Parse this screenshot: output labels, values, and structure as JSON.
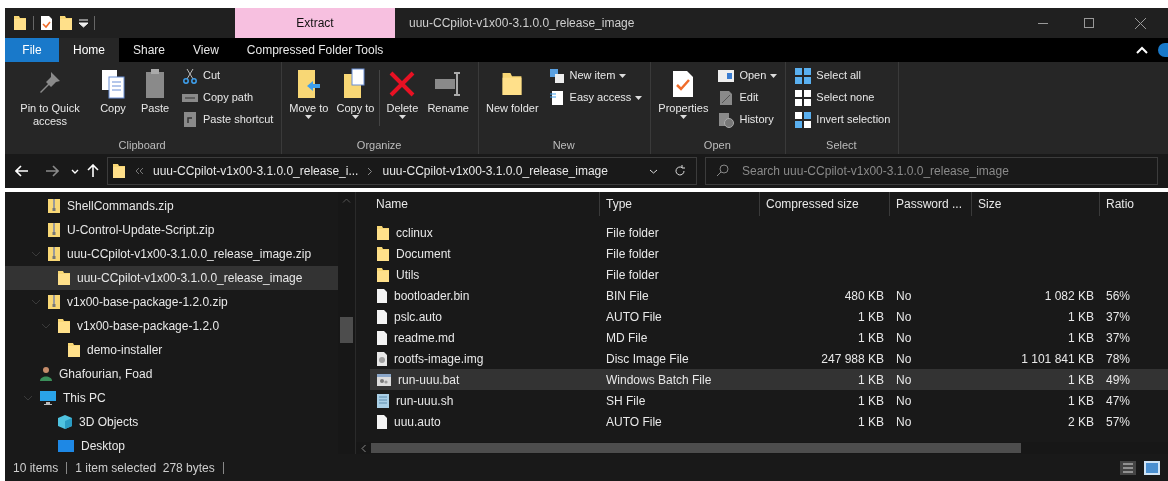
{
  "title_bar": {
    "context_tab": "Extract",
    "title": "uuu-CCpilot-v1x00-3.1.0.0_release_image"
  },
  "ribbon_tabs": [
    {
      "label": "File",
      "kind": "file",
      "selected": false
    },
    {
      "label": "Home",
      "kind": "tab",
      "selected": true
    },
    {
      "label": "Share",
      "kind": "tab",
      "selected": false
    },
    {
      "label": "View",
      "kind": "tab",
      "selected": false
    },
    {
      "label": "Compressed Folder Tools",
      "kind": "context",
      "selected": false
    }
  ],
  "ribbon_groups": [
    {
      "label": "Clipboard",
      "items": [
        {
          "label": "Pin to Quick access",
          "kind": "large"
        },
        {
          "label": "Copy",
          "kind": "large"
        },
        {
          "label": "Paste",
          "kind": "large"
        },
        {
          "kind": "stack",
          "items": [
            {
              "label": "Cut"
            },
            {
              "label": "Copy path"
            },
            {
              "label": "Paste shortcut"
            }
          ]
        }
      ]
    },
    {
      "label": "Organize",
      "items": [
        {
          "label": "Move to",
          "kind": "large",
          "dropdown": true
        },
        {
          "label": "Copy to",
          "kind": "large",
          "dropdown": true
        },
        {
          "kind": "separator"
        },
        {
          "label": "Delete",
          "kind": "large",
          "dropdown": true
        },
        {
          "label": "Rename",
          "kind": "large"
        }
      ]
    },
    {
      "label": "New",
      "items": [
        {
          "label": "New folder",
          "kind": "large"
        },
        {
          "kind": "stack",
          "items": [
            {
              "label": "New item",
              "dropdown": true
            },
            {
              "label": "Easy access",
              "dropdown": true
            }
          ]
        }
      ]
    },
    {
      "label": "Open",
      "items": [
        {
          "label": "Properties",
          "kind": "large",
          "dropdown": true
        },
        {
          "kind": "stack",
          "items": [
            {
              "label": "Open",
              "dropdown": true
            },
            {
              "label": "Edit"
            },
            {
              "label": "History"
            }
          ]
        }
      ]
    },
    {
      "label": "Select",
      "items": [
        {
          "kind": "stack",
          "items": [
            {
              "label": "Select all"
            },
            {
              "label": "Select none"
            },
            {
              "label": "Invert selection"
            }
          ]
        }
      ]
    }
  ],
  "address": {
    "crumbs": [
      "uuu-CCpilot-v1x00-3.1.0.0_release_i...",
      "uuu-CCpilot-v1x00-3.1.0.0_release_image"
    ],
    "search_placeholder": "Search uuu-CCpilot-v1x00-3.1.0.0_release_image"
  },
  "nav_tree": [
    {
      "label": "ShellCommands.zip",
      "kind": "zip",
      "selected": false
    },
    {
      "label": "U-Control-Update-Script.zip",
      "kind": "zip",
      "selected": false
    },
    {
      "label": "uuu-CCpilot-v1x00-3.1.0.0_release_image.zip",
      "kind": "zip",
      "selected": false,
      "expanded": true,
      "children": [
        {
          "label": "uuu-CCpilot-v1x00-3.1.0.0_release_image",
          "kind": "folder",
          "selected": true
        }
      ]
    },
    {
      "label": "v1x00-base-package-1.2.0.zip",
      "kind": "zip",
      "selected": false,
      "expanded": true,
      "children": [
        {
          "label": "v1x00-base-package-1.2.0",
          "kind": "folder",
          "selected": false,
          "expanded": true,
          "children": [
            {
              "label": "demo-installer",
              "kind": "folder",
              "selected": false
            }
          ]
        }
      ]
    },
    {
      "label": "Ghafourian, Foad",
      "kind": "user",
      "selected": false
    },
    {
      "label": "This PC",
      "kind": "pc",
      "selected": false,
      "expanded": true,
      "children": [
        {
          "label": "3D Objects",
          "kind": "cube",
          "selected": false
        },
        {
          "label": "Desktop",
          "kind": "desktop",
          "selected": false
        }
      ]
    }
  ],
  "file_list": {
    "columns": [
      "Name",
      "Type",
      "Compressed size",
      "Password ...",
      "Size",
      "Ratio"
    ],
    "rows": [
      {
        "name": "cclinux",
        "kind": "folder",
        "type": "File folder",
        "selected": false
      },
      {
        "name": "Document",
        "kind": "folder",
        "type": "File folder",
        "selected": false
      },
      {
        "name": "Utils",
        "kind": "folder",
        "type": "File folder",
        "selected": false
      },
      {
        "name": "bootloader.bin",
        "kind": "file",
        "type": "BIN File",
        "compressed_size": "480 KB",
        "password": "No",
        "size": "1 082 KB",
        "ratio": "56%",
        "selected": false
      },
      {
        "name": "pslc.auto",
        "kind": "file",
        "type": "AUTO File",
        "compressed_size": "1 KB",
        "password": "No",
        "size": "1 KB",
        "ratio": "37%",
        "selected": false
      },
      {
        "name": "readme.md",
        "kind": "file",
        "type": "MD File",
        "compressed_size": "1 KB",
        "password": "No",
        "size": "1 KB",
        "ratio": "37%",
        "selected": false
      },
      {
        "name": "rootfs-image.img",
        "kind": "disc",
        "type": "Disc Image File",
        "compressed_size": "247 988 KB",
        "password": "No",
        "size": "1 101 841 KB",
        "ratio": "78%",
        "selected": false
      },
      {
        "name": "run-uuu.bat",
        "kind": "batch",
        "type": "Windows Batch File",
        "compressed_size": "1 KB",
        "password": "No",
        "size": "1 KB",
        "ratio": "49%",
        "selected": true
      },
      {
        "name": "run-uuu.sh",
        "kind": "script",
        "type": "SH File",
        "compressed_size": "1 KB",
        "password": "No",
        "size": "1 KB",
        "ratio": "47%",
        "selected": false
      },
      {
        "name": "uuu.auto",
        "kind": "file",
        "type": "AUTO File",
        "compressed_size": "1 KB",
        "password": "No",
        "size": "2 KB",
        "ratio": "57%",
        "selected": false
      }
    ]
  },
  "status_bar": [
    "10 items",
    "1 item selected  278 bytes"
  ]
}
